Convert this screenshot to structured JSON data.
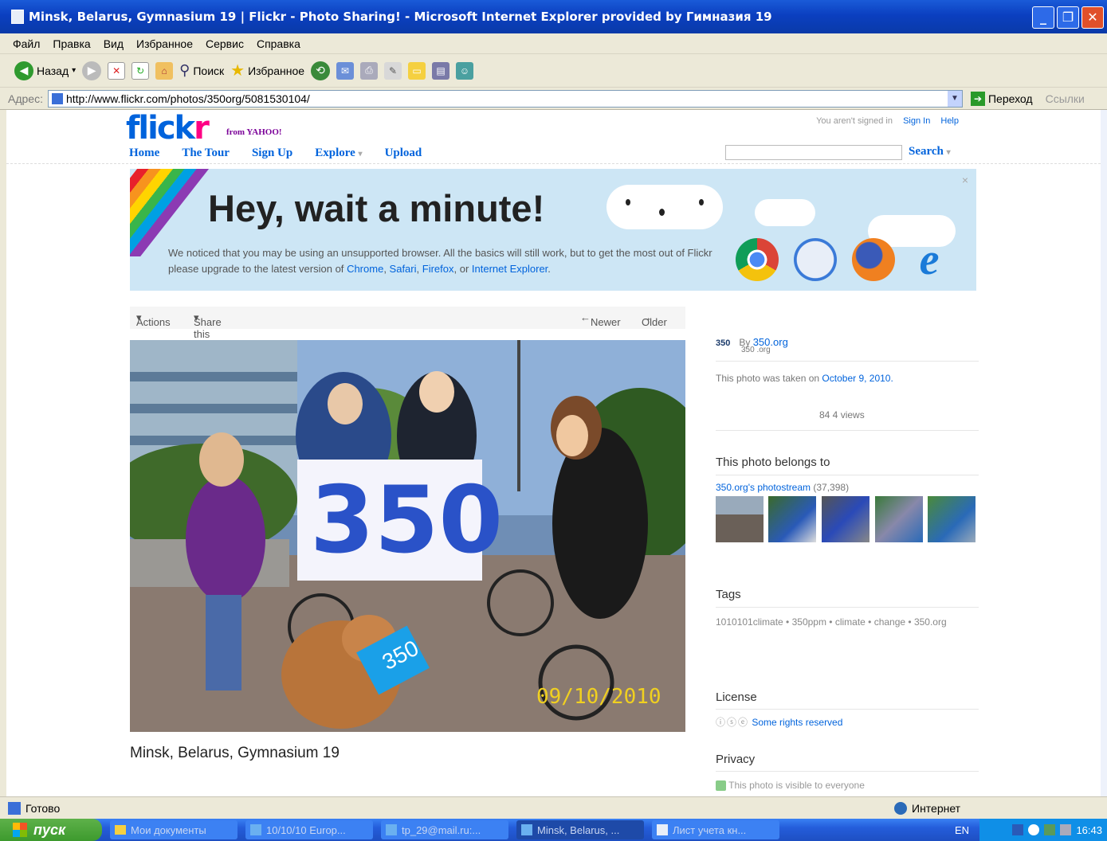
{
  "window": {
    "title": "Minsk, Belarus, Gymnasium 19 | Flickr - Photo Sharing! - Microsoft Internet Explorer provided by Гимназия 19"
  },
  "menu": [
    "Файл",
    "Правка",
    "Вид",
    "Избранное",
    "Сервис",
    "Справка"
  ],
  "toolbar": {
    "back": "Назад",
    "search": "Поиск",
    "favorites": "Избранное"
  },
  "address": {
    "label": "Адрес:",
    "url": "http://www.flickr.com/photos/350org/5081530104/",
    "go": "Переход",
    "links": "Ссылки"
  },
  "flickr": {
    "logo_blue": "flick",
    "logo_pink": "r",
    "yahoo": "from YAHOO!",
    "signed": "You aren't signed in",
    "signin": "Sign In",
    "help": "Help",
    "nav": {
      "home": "Home",
      "tour": "The Tour",
      "signup": "Sign Up",
      "explore": "Explore",
      "explore_arrow": "▾",
      "upload": "Upload"
    },
    "search_btn": "Search",
    "search_arrow": "▾"
  },
  "banner": {
    "heading": "Hey, wait a minute!",
    "message_1": "We noticed that you may be using an unsupported browser. All the basics will still work, but to get the most out of Flickr please upgrade to the latest version of",
    "chrome": "Chrome",
    "safari": "Safari",
    "firefox": "Firefox",
    "or": "or",
    "ie": "Internet Explorer",
    "close": "×"
  },
  "photo_bar": {
    "actions": "Actions",
    "share": "Share this",
    "newer": "Newer",
    "older": "Older"
  },
  "photo": {
    "caption": "Minsk, Belarus, Gymnasium 19",
    "sign_text": "350",
    "dog_sign": "350",
    "date_stamp": "09/10/2010"
  },
  "sidebar": {
    "by": "By",
    "owner": "350.org",
    "owner_sub": "350 .org",
    "owner_badge": "350",
    "taken": "This photo was taken on",
    "taken_date": "October 9, 2010.",
    "views": "84 4 views",
    "belongs_h": "This photo belongs to",
    "stream": "350.org's photostream",
    "stream_count": "(37,398)",
    "tags_h": "Tags",
    "tags": "1010101climate  •  350ppm  •  climate  •  change  •  350.org",
    "license_h": "License",
    "license": "Some rights reserved",
    "privacy_h": "Privacy",
    "privacy": "This photo is visible to everyone"
  },
  "status": {
    "ready": "Готово",
    "zone": "Интернет"
  },
  "taskbar": {
    "start": "пуск",
    "tasks": [
      "Мои документы",
      "10/10/10 Europ...",
      "tp_29@mail.ru:...",
      "Minsk, Belarus, ...",
      "Лист учета кн..."
    ],
    "lang": "EN",
    "clock": "16:43"
  }
}
